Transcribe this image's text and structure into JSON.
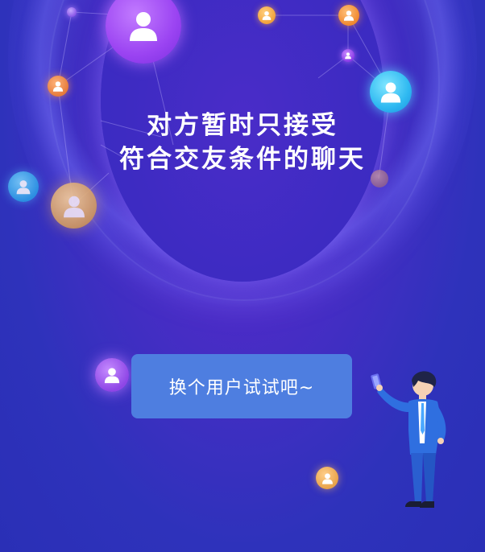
{
  "message": {
    "line1": "对方暂时只接受",
    "line2": "符合交友条件的聊天"
  },
  "actions": {
    "swap_label": "换个用户试试吧~"
  },
  "colors": {
    "background": "#2a2fb6",
    "button": "#4e7ee0",
    "text": "#ffffff"
  },
  "icons": {
    "avatar": "user-avatar-icon",
    "illustration": "person-with-phone-illustration"
  }
}
